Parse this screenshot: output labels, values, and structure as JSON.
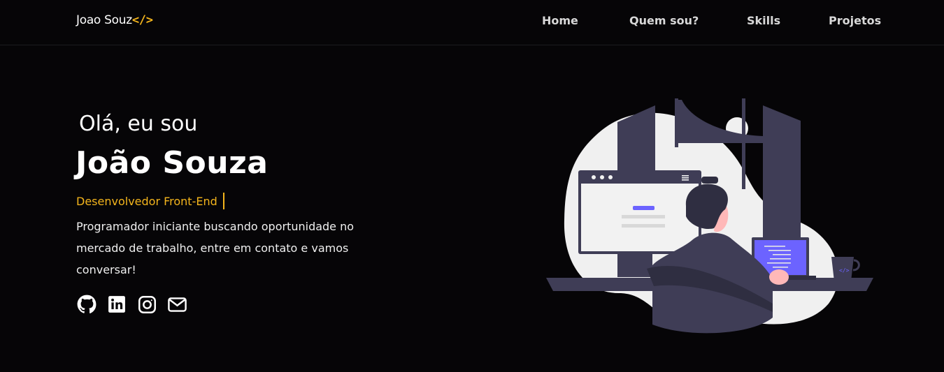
{
  "header": {
    "logo_text": "Joao Souz",
    "logo_tag": "</>",
    "nav": [
      {
        "label": "Home"
      },
      {
        "label": "Quem sou?"
      },
      {
        "label": "Skills"
      },
      {
        "label": "Projetos"
      }
    ]
  },
  "hero": {
    "greeting": "Olá, eu sou",
    "name": "João Souza",
    "role": "Desenvolvedor Front-End",
    "bio": "Programador iniciante buscando oportunidade no mercado de trabalho, entre em contato e vamos conversar!",
    "socials": [
      {
        "icon": "github-icon"
      },
      {
        "icon": "linkedin-icon"
      },
      {
        "icon": "instagram-icon"
      },
      {
        "icon": "mail-icon"
      }
    ]
  },
  "colors": {
    "accent": "#f4b51c",
    "background": "#060507",
    "illustration_purple": "#6c63ff",
    "illustration_dark": "#3f3d56"
  }
}
